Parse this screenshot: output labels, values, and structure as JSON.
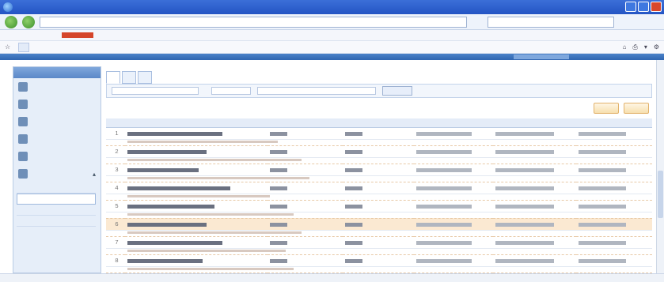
{
  "window": {
    "title": "",
    "url": "",
    "menu_items": [
      "",
      "",
      "",
      "",
      "",
      ""
    ]
  },
  "favorites": {
    "tab_label": ""
  },
  "sidebar": {
    "items": [
      {
        "label": "",
        "icon": "user-icon"
      },
      {
        "label": "",
        "icon": "person-icon"
      },
      {
        "label": "",
        "icon": "group-icon"
      },
      {
        "label": "",
        "icon": "grid-icon"
      },
      {
        "label": "",
        "icon": "list-icon"
      },
      {
        "label": "",
        "icon": "folder-icon"
      }
    ],
    "subitems": [
      "",
      "",
      "",
      ""
    ]
  },
  "main": {
    "tabs": [
      "",
      "",
      ""
    ],
    "filters": {
      "search_button": ""
    },
    "toolbar_title": ""
  },
  "table": {
    "headers": [
      "",
      "",
      "",
      "",
      "",
      "",
      ""
    ],
    "rows": [
      {
        "num": "1",
        "highlighted": false
      },
      {
        "num": "2",
        "highlighted": false
      },
      {
        "num": "3",
        "highlighted": false
      },
      {
        "num": "4",
        "highlighted": false
      },
      {
        "num": "5",
        "highlighted": false
      },
      {
        "num": "6",
        "highlighted": true
      },
      {
        "num": "7",
        "highlighted": false
      },
      {
        "num": "8",
        "highlighted": false
      }
    ]
  },
  "status": {
    "left": "",
    "zone": ""
  },
  "colors": {
    "chrome_blue": "#2455c4",
    "highlight_row": "#fbe9d2",
    "action_button": "#f7dfaf"
  }
}
